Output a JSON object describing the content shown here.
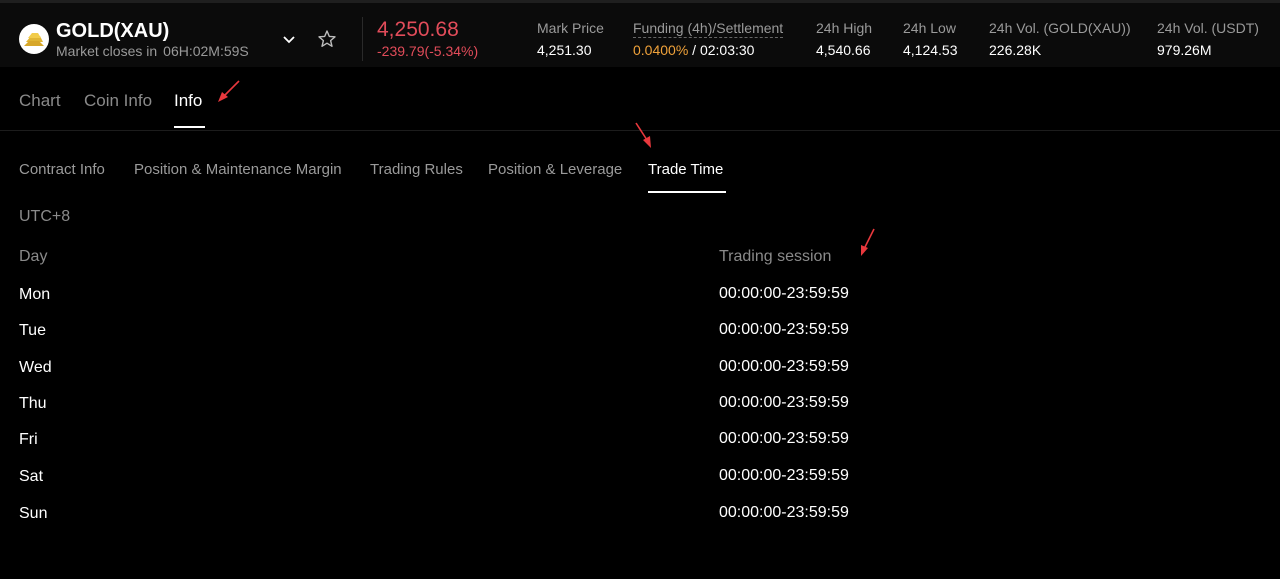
{
  "header": {
    "symbol": "GOLD(XAU)",
    "market_closes_label": "Market closes in",
    "market_closes_time": "06H:02M:59S",
    "last_price": "4,250.68",
    "change": "-239.79(-5.34%)",
    "stats": {
      "mark_price_label": "Mark Price",
      "mark_price_value": "4,251.30",
      "funding_label": "Funding (4h)/Settlement",
      "funding_rate": "0.0400%",
      "funding_sep": " / ",
      "settlement_time": "02:03:30",
      "high_label": "24h High",
      "high_value": "4,540.66",
      "low_label": "24h Low",
      "low_value": "4,124.53",
      "vol_base_label": "24h Vol. (GOLD(XAU))",
      "vol_base_value": "226.28K",
      "vol_quote_label": "24h Vol. (USDT)",
      "vol_quote_value": "979.26M"
    }
  },
  "tabs": [
    "Chart",
    "Coin Info",
    "Info"
  ],
  "subtabs": [
    "Contract Info",
    "Position & Maintenance Margin",
    "Trading Rules",
    "Position & Leverage",
    "Trade Time"
  ],
  "timezone": "UTC+8",
  "table": {
    "col_day": "Day",
    "col_session": "Trading session",
    "rows": [
      {
        "day": "Mon",
        "session": "00:00:00-23:59:59"
      },
      {
        "day": "Tue",
        "session": "00:00:00-23:59:59"
      },
      {
        "day": "Wed",
        "session": "00:00:00-23:59:59"
      },
      {
        "day": "Thu",
        "session": "00:00:00-23:59:59"
      },
      {
        "day": "Fri",
        "session": "00:00:00-23:59:59"
      },
      {
        "day": "Sat",
        "session": "00:00:00-23:59:59"
      },
      {
        "day": "Sun",
        "session": "00:00:00-23:59:59"
      }
    ]
  },
  "colors": {
    "down": "#e24c5a",
    "funding": "#f0a23a",
    "annotation_arrow": "#e8383d"
  }
}
